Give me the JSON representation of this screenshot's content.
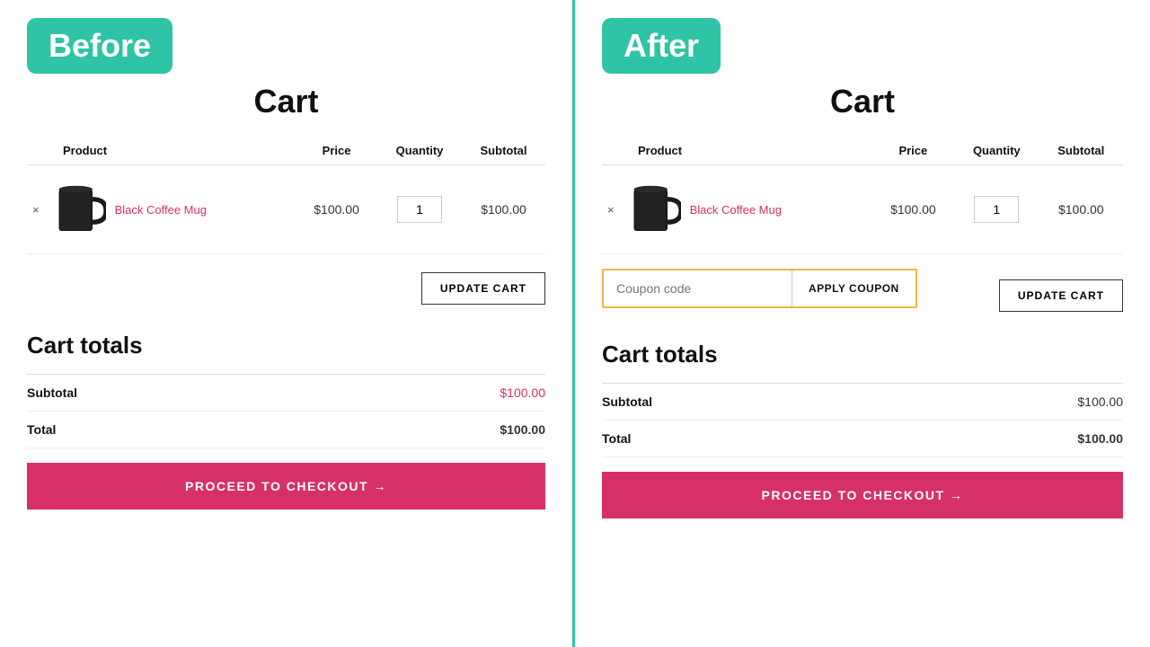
{
  "before": {
    "badge": "Before",
    "cart_title": "Cart",
    "table": {
      "headers": [
        "Product",
        "Price",
        "Quantity",
        "Subtotal"
      ],
      "row": {
        "product_name": "Black Coffee Mug",
        "price": "$100.00",
        "quantity": "1",
        "subtotal": "$100.00"
      }
    },
    "update_btn": "UPDATE CART",
    "cart_totals_title": "Cart totals",
    "subtotal_label": "Subtotal",
    "subtotal_value": "$100.00",
    "total_label": "Total",
    "total_value": "$100.00",
    "checkout_btn": "PROCEED TO CHECKOUT →"
  },
  "after": {
    "badge": "After",
    "cart_title": "Cart",
    "table": {
      "headers": [
        "Product",
        "Price",
        "Quantity",
        "Subtotal"
      ],
      "row": {
        "product_name": "Black Coffee Mug",
        "price": "$100.00",
        "quantity": "1",
        "subtotal": "$100.00"
      }
    },
    "coupon_placeholder": "Coupon code",
    "apply_btn": "APPLY COUPON",
    "update_btn": "UPDATE CART",
    "cart_totals_title": "Cart totals",
    "subtotal_label": "Subtotal",
    "subtotal_value": "$100.00",
    "total_label": "Total",
    "total_value": "$100.00",
    "checkout_btn": "PROCEED TO CHECKOUT →"
  },
  "colors": {
    "teal": "#2ec4a5",
    "pink": "#d63067",
    "gold": "#e8b84b"
  }
}
